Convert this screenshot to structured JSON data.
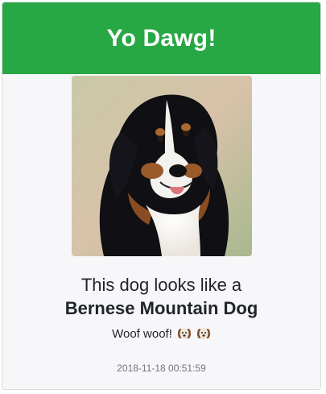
{
  "header": {
    "title": "Yo Dawg!"
  },
  "result": {
    "prefix": "This dog looks like a",
    "breed": "Bernese Mountain Dog",
    "woof_text": "Woof woof!",
    "emoji_icons": [
      "dog-face-icon",
      "dog-face-icon"
    ],
    "timestamp": "2018-11-18 00:51:59"
  },
  "colors": {
    "header_bg": "#28a745",
    "card_bg": "#f7f7f9",
    "text": "#212529",
    "muted": "#6c757d"
  }
}
